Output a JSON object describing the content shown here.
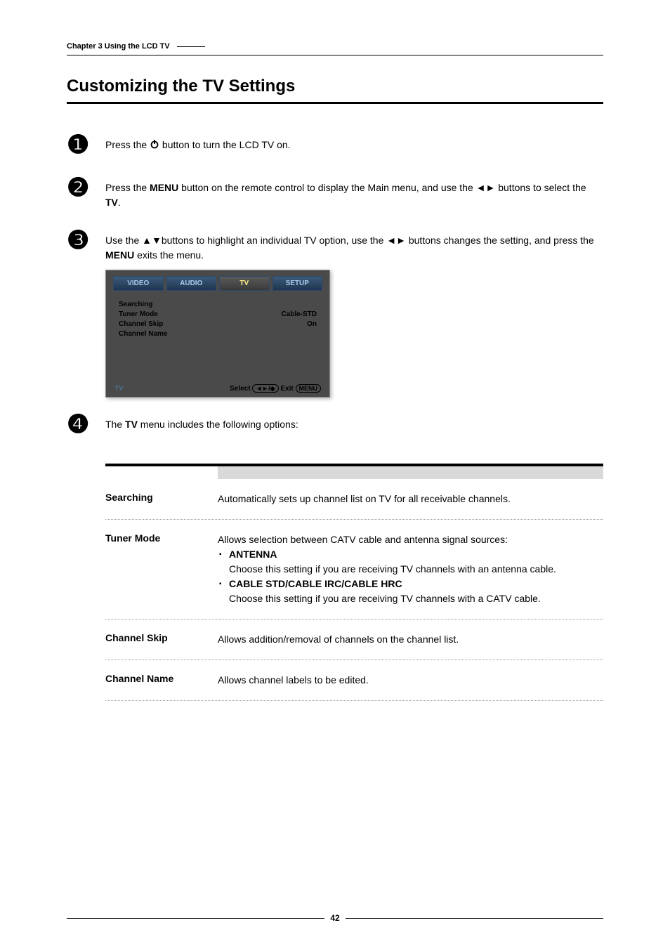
{
  "header": {
    "chapter": "Chapter 3 Using the LCD TV"
  },
  "title": "Customizing the TV Settings",
  "steps": {
    "s1": {
      "num": "❶",
      "text_before": "Press the ",
      "text_after": " button to turn the LCD TV on."
    },
    "s2": {
      "num": "❷",
      "t1": "Press the ",
      "menu": "MENU",
      "t2": " button on the remote control to display the Main menu, and use the ◄► buttons to select the ",
      "tv": "TV",
      "t3": "."
    },
    "s3": {
      "num": "❸",
      "t1": "Use the ▲▼buttons to highlight an individual TV option, use the ◄► buttons changes the setting, and press the ",
      "menu": "MENU",
      "t2": " exits the menu."
    },
    "s4": {
      "num": "❹",
      "t1": "The ",
      "tv": "TV",
      "t2": " menu includes the following options:"
    }
  },
  "menu_image": {
    "tabs": {
      "video": "VIDEO",
      "audio": "AUDIO",
      "tv": "TV",
      "setup": "SETUP"
    },
    "rows": {
      "r1": {
        "label": "Searching",
        "value": ""
      },
      "r2": {
        "label": "Tuner Mode",
        "value": "Cable-STD"
      },
      "r3": {
        "label": "Channel Skip",
        "value": "On"
      },
      "r4": {
        "label": "Channel Name",
        "value": ""
      }
    },
    "footer": {
      "left": "TV",
      "select": "Select",
      "nav": "◄►/◆",
      "exit": "Exit",
      "menu": "MENU"
    }
  },
  "options": {
    "searching": {
      "label": "Searching",
      "desc": "Automatically sets up channel list on TV for all receivable channels."
    },
    "tuner": {
      "label": "Tuner Mode",
      "intro": "Allows selection between CATV cable and antenna signal sources:",
      "item1_title": "ANTENNA",
      "item1_desc": "Choose this setting if you are receiving TV channels with an antenna cable.",
      "item2_title": "CABLE STD/CABLE IRC/CABLE HRC",
      "item2_desc": "Choose this setting if you are receiving TV channels with a CATV cable."
    },
    "skip": {
      "label": "Channel Skip",
      "desc": "Allows addition/removal of channels on the channel list."
    },
    "name": {
      "label": "Channel Name",
      "desc": "Allows channel labels to be edited."
    }
  },
  "page_number": "42"
}
